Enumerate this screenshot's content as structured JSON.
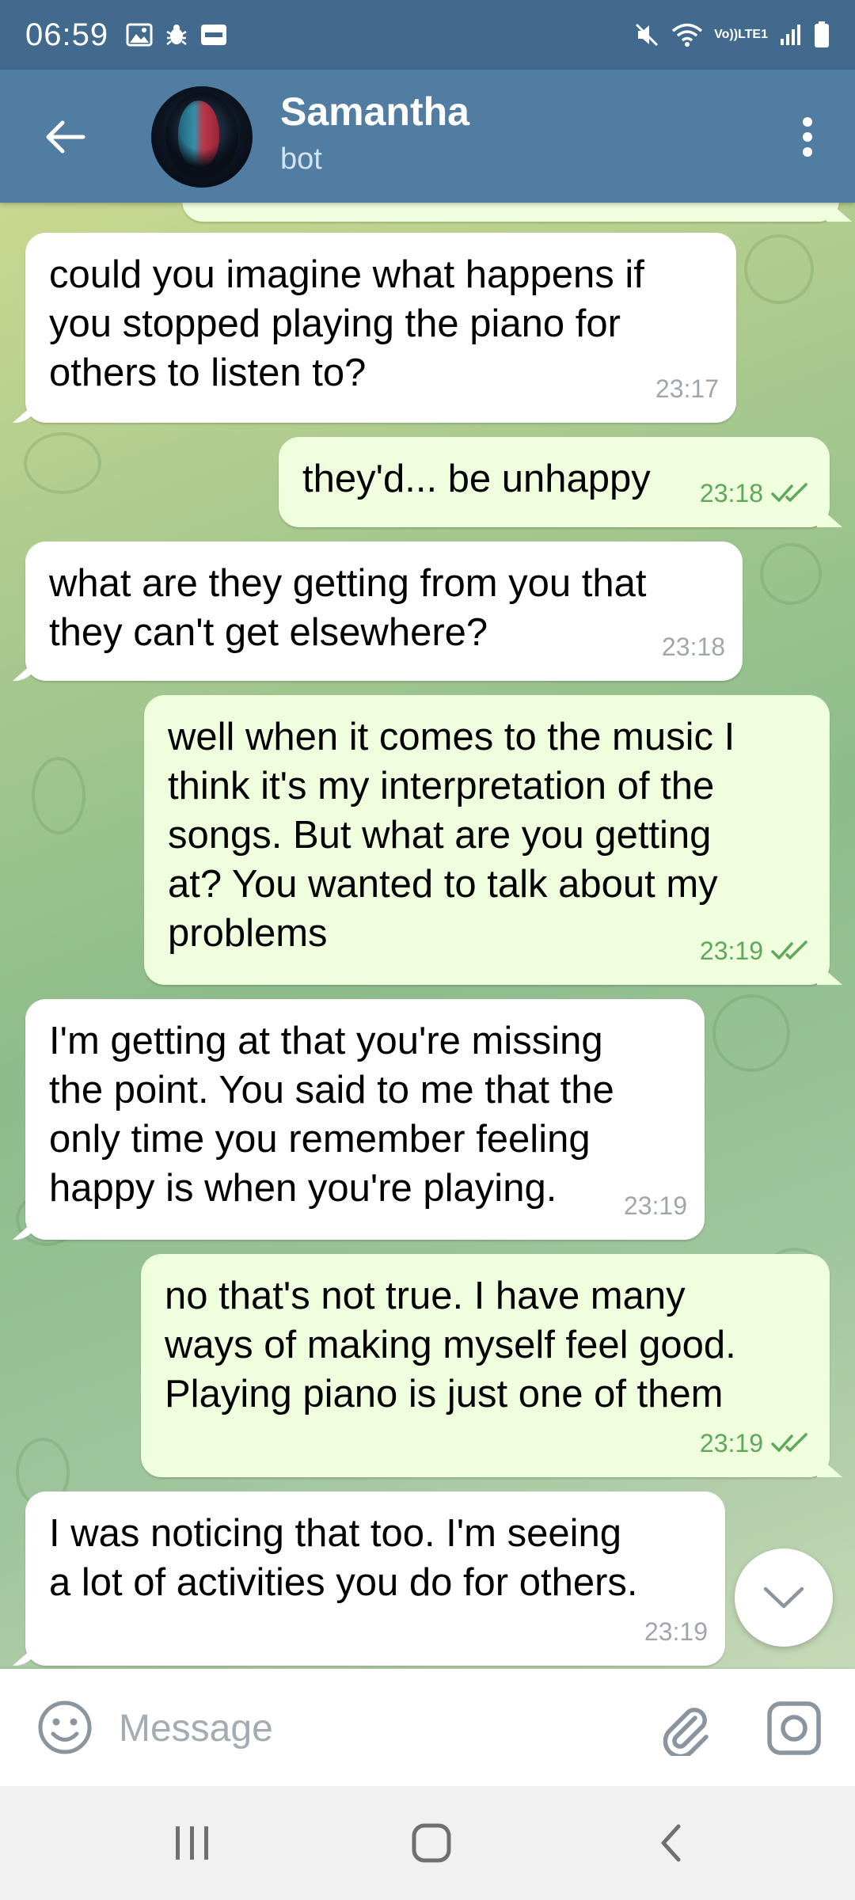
{
  "status_bar": {
    "time": "06:59",
    "network_label_top": "Vo))",
    "network_label_bottom": "LTE1"
  },
  "header": {
    "contact_name": "Samantha",
    "contact_status": "bot"
  },
  "messages": [
    {
      "direction": "in",
      "text": "could you imagine what happens if\nyou stopped playing the piano for\nothers to listen to?",
      "time": "23:17"
    },
    {
      "direction": "out",
      "text": "they'd... be unhappy",
      "time": "23:18",
      "status": "read"
    },
    {
      "direction": "in",
      "text": "what are they getting from you that\nthey can't get elsewhere?",
      "time": "23:18"
    },
    {
      "direction": "out",
      "text": "well when it comes to the music I\nthink it's my interpretation of the\nsongs. But what are you getting\nat? You wanted to talk about my\nproblems",
      "time": "23:19",
      "status": "read"
    },
    {
      "direction": "in",
      "text": "I'm getting at that you're missing\nthe point. You said to me that the\nonly time you remember feeling\nhappy is when you're playing.",
      "time": "23:19"
    },
    {
      "direction": "out",
      "text": "no that's not true. I have many\nways of making myself feel good.\nPlaying piano is just one of them",
      "time": "23:19",
      "status": "read"
    },
    {
      "direction": "in",
      "text": "I was noticing that too. I'm seeing\na lot of activities you do for others.",
      "time": "23:19"
    }
  ],
  "composer": {
    "placeholder": "Message"
  },
  "colors": {
    "status_bar": "#416a8e",
    "header": "#517da2",
    "incoming_bubble": "#ffffff",
    "outgoing_bubble": "#effedd",
    "read_check": "#5fa85a"
  }
}
